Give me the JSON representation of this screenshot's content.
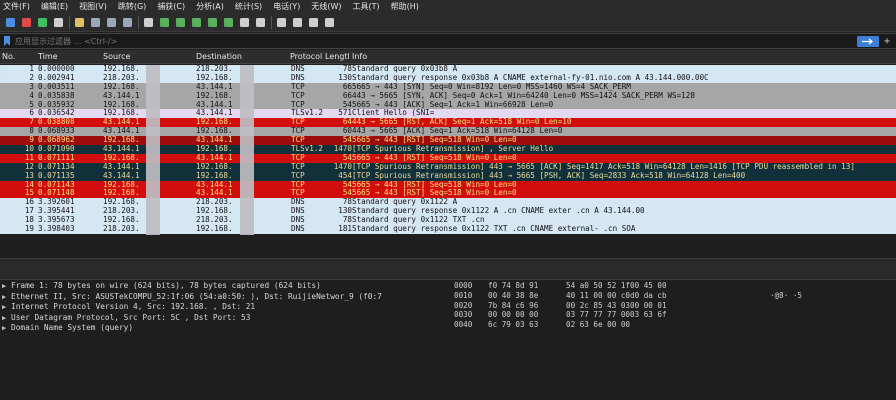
{
  "menu": [
    {
      "label": "文件(F)",
      "name": "menu-file"
    },
    {
      "label": "编辑(E)",
      "name": "menu-edit"
    },
    {
      "label": "视图(V)",
      "name": "menu-view"
    },
    {
      "label": "跳转(G)",
      "name": "menu-go"
    },
    {
      "label": "捕获(C)",
      "name": "menu-capture"
    },
    {
      "label": "分析(A)",
      "name": "menu-analyze"
    },
    {
      "label": "统计(S)",
      "name": "menu-statistics"
    },
    {
      "label": "电话(Y)",
      "name": "menu-telephony"
    },
    {
      "label": "无线(W)",
      "name": "menu-wireless"
    },
    {
      "label": "工具(T)",
      "name": "menu-tools"
    },
    {
      "label": "帮助(H)",
      "name": "menu-help"
    }
  ],
  "toolbar": [
    {
      "icon": "shark-fin-start-icon",
      "color": "#4a90e2"
    },
    {
      "icon": "stop-capture-icon",
      "color": "#e24a4a"
    },
    {
      "icon": "restart-capture-icon",
      "color": "#3fbf5f"
    },
    {
      "icon": "capture-options-icon",
      "color": "#cfcfcf"
    },
    {
      "sep": true
    },
    {
      "icon": "open-file-icon",
      "color": "#e0c060"
    },
    {
      "icon": "save-file-icon",
      "color": "#9aa7b8"
    },
    {
      "icon": "close-file-icon",
      "color": "#9aa7b8"
    },
    {
      "icon": "reload-file-icon",
      "color": "#9aa7b8"
    },
    {
      "sep": true
    },
    {
      "icon": "find-packet-icon",
      "color": "#cfcfcf"
    },
    {
      "icon": "go-back-icon",
      "color": "#5ab05a"
    },
    {
      "icon": "go-forward-icon",
      "color": "#5ab05a"
    },
    {
      "icon": "go-to-packet-icon",
      "color": "#5ab05a"
    },
    {
      "icon": "go-first-icon",
      "color": "#5ab05a"
    },
    {
      "icon": "go-last-icon",
      "color": "#5ab05a"
    },
    {
      "icon": "auto-scroll-icon",
      "color": "#cfcfcf"
    },
    {
      "icon": "colorize-icon",
      "color": "#cfcfcf"
    },
    {
      "sep": true
    },
    {
      "icon": "zoom-in-icon",
      "color": "#cfcfcf"
    },
    {
      "icon": "zoom-out-icon",
      "color": "#cfcfcf"
    },
    {
      "icon": "zoom-normal-icon",
      "color": "#cfcfcf"
    },
    {
      "icon": "resize-columns-icon",
      "color": "#cfcfcf"
    }
  ],
  "filter": {
    "placeholder": "应用显示过滤器 … <Ctrl-/>"
  },
  "columns": {
    "no": "No.",
    "time": "Time",
    "source": "Source",
    "destination": "Destination",
    "protocol": "Protocol",
    "length": "Lengtl",
    "info": "Info"
  },
  "packets": [
    {
      "no": "1",
      "time": "0.000000",
      "src": "192.168.",
      "dst": "218.203.",
      "proto": "DNS",
      "len": "78",
      "info": "Standard query 0x03b8 A",
      "style": "bg-dns",
      "mark": "→"
    },
    {
      "no": "2",
      "time": "0.002941",
      "src": "218.203.",
      "dst": "192.168.",
      "proto": "DNS",
      "len": "130",
      "info": "Standard query response 0x03b8 A                  CNAME external-fy-01.nio.com A 43.144.000.00C",
      "style": "bg-dns",
      "mark": "←"
    },
    {
      "no": "3",
      "time": "0.003511",
      "src": "192.168.",
      "dst": "43.144.1",
      "proto": "TCP",
      "len": "66",
      "info": "5665 → 443 [SYN] Seq=0 Win=8192 Len=0 MSS=1460 WS=4 SACK_PERM",
      "style": "bg-tcp",
      "mark": ""
    },
    {
      "no": "4",
      "time": "0.035838",
      "src": "43.144.1",
      "dst": "192.168.",
      "proto": "TCP",
      "len": "66",
      "info": "443 → 5665 [SYN, ACK] Seq=0 Ack=1 Win=64240 Len=0 MSS=1424 SACK_PERM WS=128",
      "style": "bg-tcp",
      "mark": ""
    },
    {
      "no": "5",
      "time": "0.035932",
      "src": "192.168.",
      "dst": "43.144.1",
      "proto": "TCP",
      "len": "54",
      "info": "5665 → 443 [ACK] Seq=1 Ack=1 Win=66928 Len=0",
      "style": "bg-tcp",
      "mark": ""
    },
    {
      "no": "6",
      "time": "0.036542",
      "src": "192.168.",
      "dst": "43.144.1",
      "proto": "TLSv1.2",
      "len": "571",
      "info": "Client Hello (SNI=",
      "style": "bg-tls",
      "mark": ""
    },
    {
      "no": "7",
      "time": "0.038808",
      "src": "43.144.1",
      "dst": "192.168.",
      "proto": "TCP",
      "len": "64",
      "info": "443 → 5665 [RST, ACK] Seq=1 Ack=518 Win=0 Len=10",
      "style": "bg-sel",
      "mark": ""
    },
    {
      "no": "8",
      "time": "0.068933",
      "src": "43.144.1",
      "dst": "192.168.",
      "proto": "TCP",
      "len": "60",
      "info": "443 → 5665 [ACK] Seq=1 Ack=518 Win=64128 Len=0",
      "style": "bg-tcp",
      "mark": ""
    },
    {
      "no": "9",
      "time": "0.068962",
      "src": "192.168.",
      "dst": "43.144.1",
      "proto": "TCP",
      "len": "54",
      "info": "5665 → 443 [RST] Seq=518 Win=0 Len=0",
      "style": "bg-rst",
      "mark": ""
    },
    {
      "no": "10",
      "time": "0.071090",
      "src": "43.144.1",
      "dst": "192.168.",
      "proto": "TLSv1.2",
      "len": "1470",
      "info": "[TCP Spurious Retransmission] , Server Hello",
      "style": "bg-dark",
      "mark": ""
    },
    {
      "no": "11",
      "time": "0.071111",
      "src": "192.168.",
      "dst": "43.144.1",
      "proto": "TCP",
      "len": "54",
      "info": "5665 → 443 [RST] Seq=518 Win=0 Len=0",
      "style": "bg-sel",
      "mark": ""
    },
    {
      "no": "12",
      "time": "0.071134",
      "src": "43.144.1",
      "dst": "192.168.",
      "proto": "TCP",
      "len": "1470",
      "info": "[TCP Spurious Retransmission] 443 → 5665 [ACK] Seq=1417 Ack=518 Win=64128 Len=1416 [TCP PDU reassembled in 13]",
      "style": "bg-dark",
      "mark": ""
    },
    {
      "no": "13",
      "time": "0.071135",
      "src": "43.144.1",
      "dst": "192.168.",
      "proto": "TCP",
      "len": "454",
      "info": "[TCP Spurious Retransmission] 443 → 5665 [PSH, ACK] Seq=2833 Ack=518 Win=64128 Len=400",
      "style": "bg-dark",
      "mark": ""
    },
    {
      "no": "14",
      "time": "0.071143",
      "src": "192.168.",
      "dst": "43.144.1",
      "proto": "TCP",
      "len": "54",
      "info": "5665 → 443 [RST] Seq=518 Win=0 Len=0",
      "style": "bg-sel",
      "mark": ""
    },
    {
      "no": "15",
      "time": "0.071148",
      "src": "192.168.",
      "dst": "43.144.1",
      "proto": "TCP",
      "len": "54",
      "info": "5665 → 443 [RST] Seq=518 Win=0 Len=0",
      "style": "bg-sel",
      "mark": ""
    },
    {
      "no": "16",
      "time": "3.392601",
      "src": "192.168.",
      "dst": "218.203.",
      "proto": "DNS",
      "len": "78",
      "info": "Standard query 0x1122 A",
      "style": "bg-dns",
      "mark": ""
    },
    {
      "no": "17",
      "time": "3.395441",
      "src": "218.203.",
      "dst": "192.168.",
      "proto": "DNS",
      "len": "130",
      "info": "Standard query response 0x1122 A               .cn CNAME exter              .cn A 43.144.00",
      "style": "bg-dns",
      "mark": ""
    },
    {
      "no": "18",
      "time": "3.395673",
      "src": "192.168.",
      "dst": "218.203.",
      "proto": "DNS",
      "len": "78",
      "info": "Standard query 0x1122 TXT              .cn",
      "style": "bg-dns",
      "mark": ""
    },
    {
      "no": "19",
      "time": "3.398403",
      "src": "218.203.",
      "dst": "192.168.",
      "proto": "DNS",
      "len": "181",
      "info": "Standard query response 0x1122 TXT              .cn CNAME external-              .cn SOA",
      "style": "bg-dns",
      "mark": ""
    }
  ],
  "details": [
    "Frame 1: 78 bytes on wire (624 bits), 78 bytes captured (624 bits)",
    "Ethernet II, Src: ASUSTekCOMPU_52:1f:06 (54:a0:50:       ), Dst: RuijieNetwor_9       (f0:7",
    "Internet Protocol Version 4, Src: 192.168.      , Dst: 21",
    "User Datagram Protocol, Src Port: 5C    , Dst Port: 53",
    "Domain Name System (query)"
  ],
  "hex": [
    {
      "off": "0000",
      "a": "f0 74 8d 91",
      "b": "54 a0 50 52 1f",
      "c": "00 45 00",
      "asc": ""
    },
    {
      "off": "0010",
      "a": "00 40 38 8e",
      "b": "40 11 00 00 c0",
      "c": "d0 da cb",
      "asc": "·@8·  ·5"
    },
    {
      "off": "0020",
      "a": "7b 84 c6 96",
      "b": "00 2c 85 43 03",
      "c": "00 00 01",
      "asc": ""
    },
    {
      "off": "0030",
      "a": "00 00 00 00",
      "b": "03 77 77 77 00",
      "c": "03 63 6f",
      "asc": ""
    },
    {
      "off": "0040",
      "a": "6c 79 03 63",
      "b": "02 63 6e 00 00",
      "c": "",
      "asc": ""
    }
  ]
}
